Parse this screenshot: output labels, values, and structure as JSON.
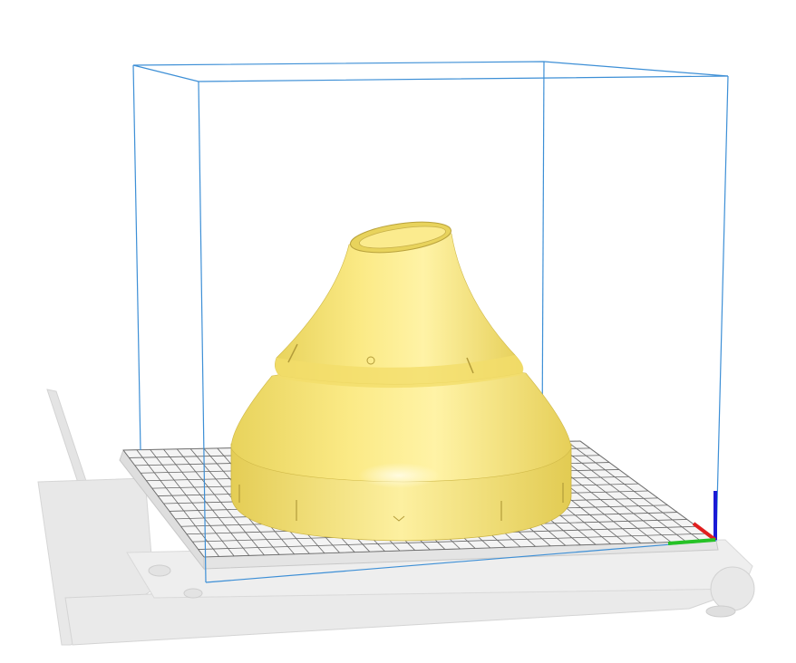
{
  "viewport": {
    "kind": "3d-print-slicer-preview",
    "background_color": "#ffffff",
    "model": {
      "shape": "cone-shaped funnel with cylindrical base and angled top opening",
      "color": "#f7e47a",
      "highlight_color": "#fff6b8",
      "shadow_color": "#d9c24a"
    },
    "build_volume": {
      "outline_color": "#3d8fd6"
    },
    "build_plate": {
      "grid_color": "#5a5a5a",
      "plate_color": "#ebebeb"
    },
    "printer_frame": {
      "color": "#d8d8d8"
    },
    "axes": {
      "x_color": "#25c225",
      "y_color": "#e01e1e",
      "z_color": "#1a1ad6"
    }
  }
}
